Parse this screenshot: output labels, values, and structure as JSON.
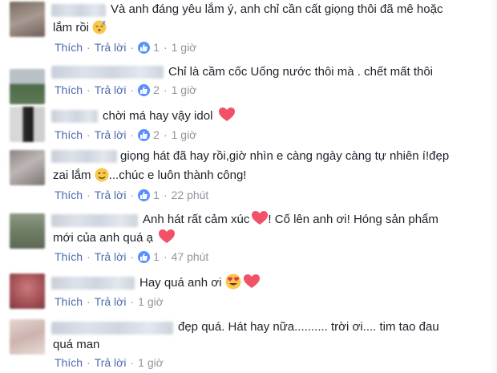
{
  "comments": [
    {
      "lines": [
        "Và anh đáng yêu lắm ý, anh chỉ cần cất giọng thôi đã mê hoặc",
        "lắm rồi"
      ],
      "emoji_names": [
        "sleepy-face-icon"
      ],
      "action_like": "Thích",
      "action_reply": "Trả lời",
      "likes": "1",
      "time": "1 giờ"
    },
    {
      "lines": [
        "Chỉ là cầm cốc Uống nước thôi mà . chết mất thôi"
      ],
      "action_like": "Thích",
      "action_reply": "Trả lời",
      "likes": "2",
      "time": "1 giờ"
    },
    {
      "lines": [
        "chời má hay vậy idol"
      ],
      "emoji_names": [
        "heart-icon"
      ],
      "action_like": "Thích",
      "action_reply": "Trả lời",
      "likes": "2",
      "time": "1 giờ"
    },
    {
      "lines": [
        "giọng hát đã hay rồi,giờ nhìn e càng ngày càng tự nhiên í!đẹp",
        "zai lắm",
        "...chúc e luôn thành công!"
      ],
      "emoji_names": [
        "winking-face-icon"
      ],
      "action_like": "Thích",
      "action_reply": "Trả lời",
      "likes": "1",
      "time": "22 phút"
    },
    {
      "lines": [
        "Anh hát rất cảm xúc",
        "! Cố lên anh ơi! Hóng sản phẩm",
        "mới của anh quá ạ"
      ],
      "emoji_names": [
        "heart-icon",
        "heart-icon"
      ],
      "action_like": "Thích",
      "action_reply": "Trả lời",
      "likes": "1",
      "time": "47 phút"
    },
    {
      "lines": [
        "Hay quá anh ơi"
      ],
      "emoji_names": [
        "heart-eyes-icon",
        "heart-icon"
      ],
      "action_like": "Thích",
      "action_reply": "Trả lời",
      "time": "1 giờ"
    },
    {
      "lines": [
        "đẹp quá. Hát hay nữa.......... trời ơi.... tim tao đau",
        "quá man"
      ],
      "action_like": "Thích",
      "action_reply": "Trả lời",
      "time": "1 giờ"
    }
  ],
  "colors": {
    "link": "#4b6bac",
    "meta": "#90949c",
    "text": "#1d2129",
    "like_badge": "#5890ff",
    "heart": "#f25268"
  }
}
